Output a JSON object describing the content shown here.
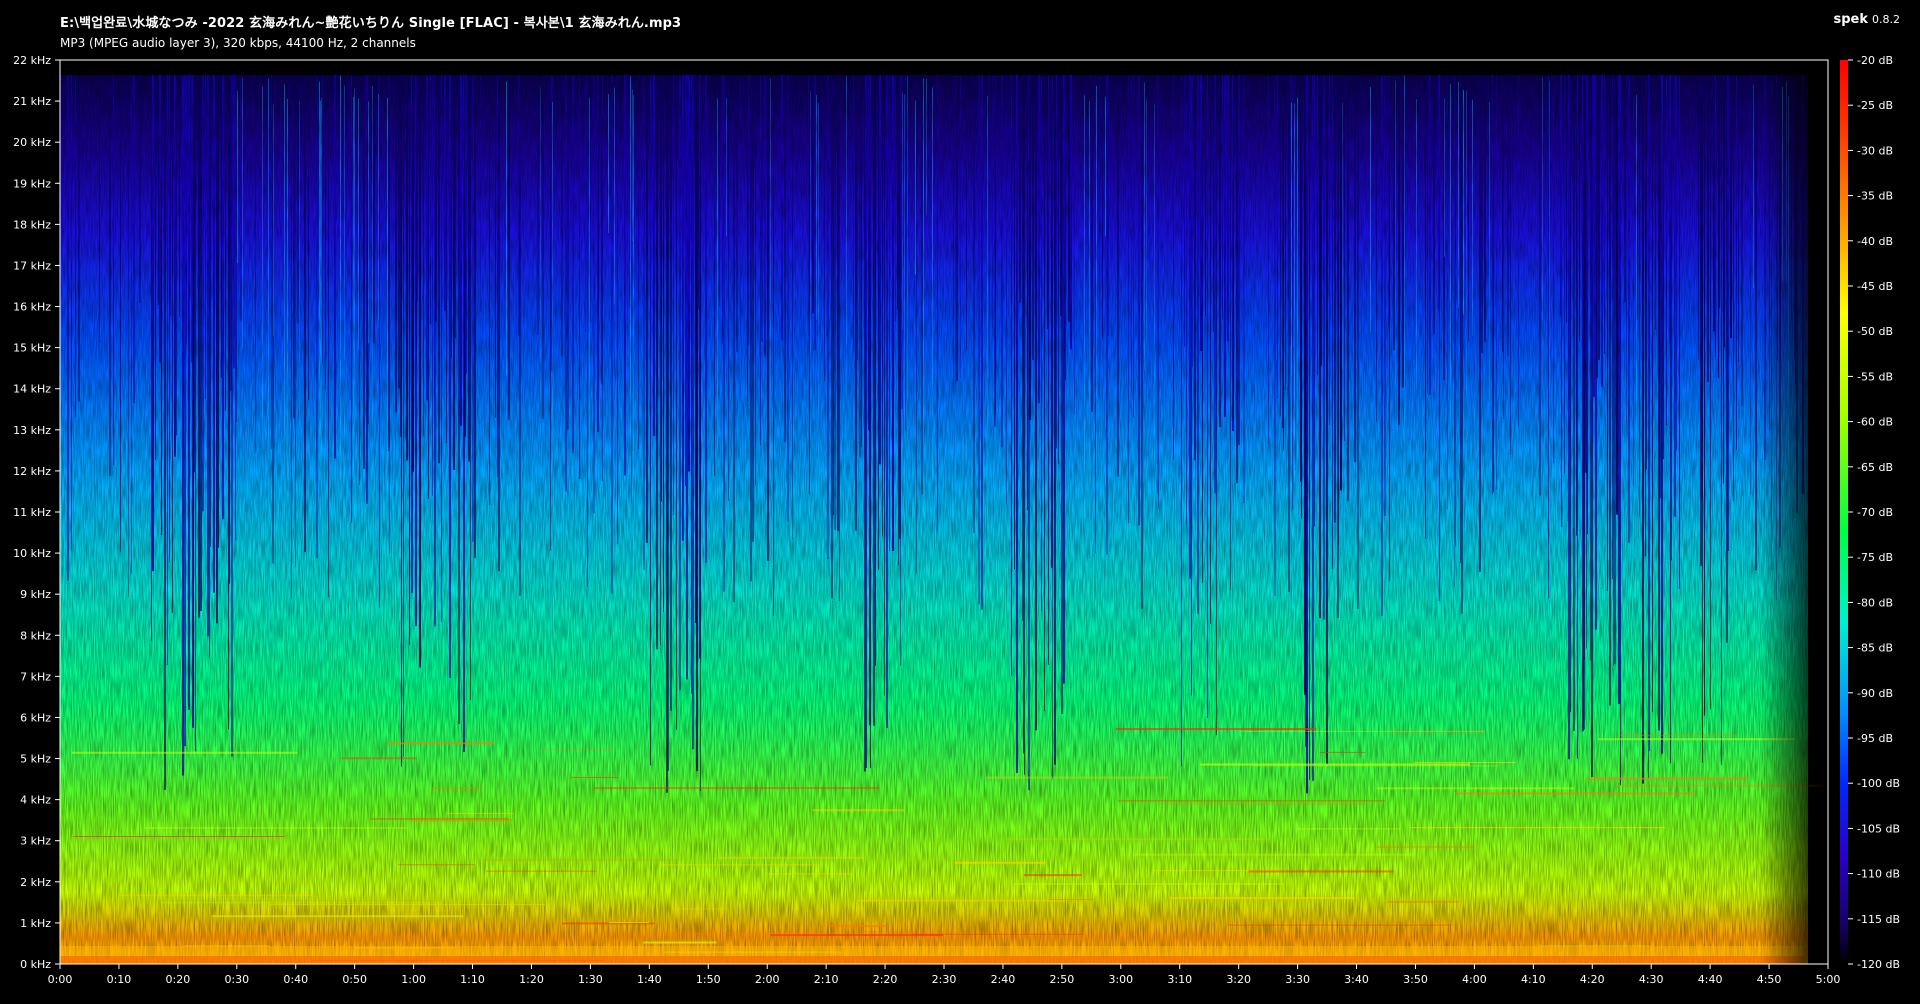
{
  "header": {
    "file_path": "E:\\백업완료\\水城なつみ -2022 玄海みれん~艶花いちりん Single [FLAC] - 복사본\\1 玄海みれん.mp3",
    "file_info": "MP3 (MPEG audio layer 3), 320 kbps, 44100 Hz, 2 channels",
    "app_name": "spek",
    "app_version": "0.8.2"
  },
  "colors": {
    "background": "#000000",
    "text": "#ffffff",
    "axis": "#ffffff",
    "palette": [
      "#000000",
      "#1a0045",
      "#2400a8",
      "#0014ff",
      "#0078ff",
      "#00d2ff",
      "#00ffa0",
      "#18ff00",
      "#9eff00",
      "#ffff00",
      "#ffa000",
      "#ff2a00",
      "#ff0000"
    ]
  },
  "frequency_axis": {
    "labels": [
      "0 kHz",
      "1 kHz",
      "2 kHz",
      "3 kHz",
      "4 kHz",
      "5 kHz",
      "6 kHz",
      "7 kHz",
      "8 kHz",
      "9 kHz",
      "10 kHz",
      "11 kHz",
      "12 kHz",
      "13 kHz",
      "14 kHz",
      "15 kHz",
      "16 kHz",
      "17 kHz",
      "18 kHz",
      "19 kHz",
      "20 kHz",
      "21 kHz",
      "22 kHz"
    ],
    "min_khz": 0,
    "max_khz": 22
  },
  "time_axis": {
    "labels": [
      "0:00",
      "0:10",
      "0:20",
      "0:30",
      "0:40",
      "0:50",
      "1:00",
      "1:10",
      "1:20",
      "1:30",
      "1:40",
      "1:50",
      "2:00",
      "2:10",
      "2:20",
      "2:30",
      "2:40",
      "2:50",
      "3:00",
      "3:10",
      "3:20",
      "3:30",
      "3:40",
      "3:50",
      "4:00",
      "4:10",
      "4:20",
      "4:30",
      "4:40",
      "4:50",
      "5:00"
    ],
    "duration_seconds": 300,
    "audio_end_seconds": 296
  },
  "db_scale": {
    "labels": [
      "-20 dB",
      "-25 dB",
      "-30 dB",
      "-35 dB",
      "-40 dB",
      "-45 dB",
      "-50 dB",
      "-55 dB",
      "-60 dB",
      "-65 dB",
      "-70 dB",
      "-75 dB",
      "-80 dB",
      "-85 dB",
      "-90 dB",
      "-95 dB",
      "-100 dB",
      "-105 dB",
      "-110 dB",
      "-115 dB",
      "-120 dB"
    ],
    "max_db": -20,
    "min_db": -120
  }
}
